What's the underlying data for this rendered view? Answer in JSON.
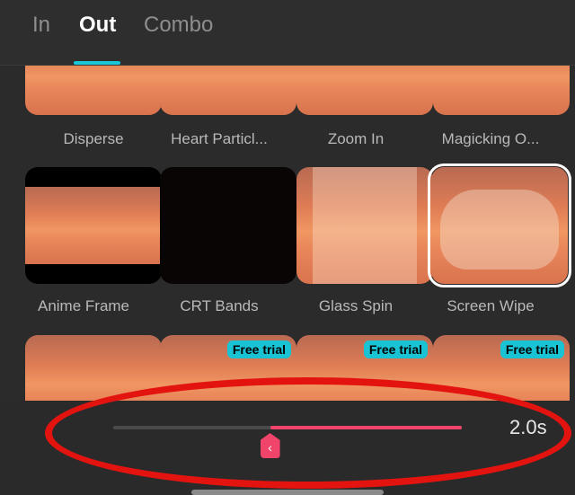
{
  "tabs": [
    {
      "label": "In",
      "active": false
    },
    {
      "label": "Out",
      "active": true
    },
    {
      "label": "Combo",
      "active": false
    }
  ],
  "effects": [
    {
      "label": "Disperse"
    },
    {
      "label": "Heart Particl..."
    },
    {
      "label": "Zoom In"
    },
    {
      "label": "Magicking O..."
    },
    {
      "label": "Anime Frame"
    },
    {
      "label": "CRT Bands"
    },
    {
      "label": "Glass Spin"
    },
    {
      "label": "Screen Wipe",
      "selected": true
    },
    {
      "label": "",
      "badge": ""
    },
    {
      "label": "",
      "badge": "Free trial"
    },
    {
      "label": "",
      "badge": "Free trial"
    },
    {
      "label": "",
      "badge": "Free trial"
    }
  ],
  "duration": {
    "value": "2.0s",
    "fraction": 0.45
  },
  "colors": {
    "accent": "#18c6d6",
    "slider": "#f0446b",
    "highlight": "#e3140f"
  }
}
